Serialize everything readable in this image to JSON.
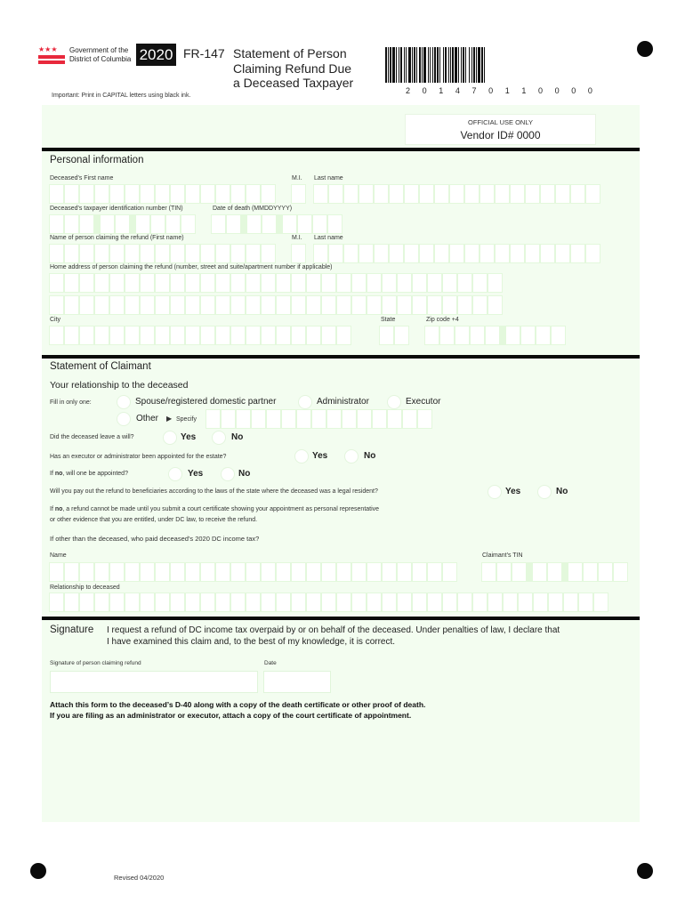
{
  "header": {
    "agency_line1": "Government of the",
    "agency_line2": "District of Columbia",
    "flag_stars": "★★★",
    "year": "2020",
    "form_number": "FR-147",
    "title_line1": "Statement of Person",
    "title_line2": "Claiming Refund Due",
    "title_line3": "a Deceased Taxpayer",
    "important_note": "Important: Print in CAPITAL letters using black ink.",
    "barcode_digits": [
      "2",
      "0",
      "1",
      "4",
      "7",
      "0",
      "1",
      "1",
      "0",
      "0",
      "0",
      "0"
    ],
    "official_use_label": "OFFICIAL USE ONLY",
    "vendor_id": "Vendor ID# 0000"
  },
  "personal": {
    "section_title": "Personal information",
    "deceased_first_name_label": "Deceased's First name",
    "mi_label": "M.I.",
    "last_name_label": "Last name",
    "tin_label": "Deceased's taxpayer identification number (TIN)",
    "date_of_death_label": "Date of death (MMDDYYYY)",
    "claimant_first_name_label": "Name of person claiming the refund (First name)",
    "claimant_mi_label": "M.I.",
    "claimant_last_name_label": "Last name",
    "address_label": "Home address of person claiming the refund (number, street and suite/apartment number if applicable)",
    "city_label": "City",
    "state_label": "State",
    "zip_label": "Zip code +4"
  },
  "claimant": {
    "section_title": "Statement of Claimant",
    "relationship_heading": "Your relationship to the deceased",
    "fill_in_label": "Fill in only one:",
    "options": {
      "spouse": "Spouse/registered domestic partner",
      "administrator": "Administrator",
      "executor": "Executor",
      "other": "Other",
      "specify": "Specify"
    },
    "q_will": "Did the deceased leave a will?",
    "q_appointed": "Has an executor or administrator been appointed for the estate?",
    "q_will_be_appointed_prefix": "If ",
    "q_will_be_appointed_bold": "no",
    "q_will_be_appointed_rest": ", will one be appointed?",
    "q_payout": "Will you pay out the refund to beneficiaries according to the laws of the state where the deceased was a legal resident?",
    "note_prefix": "If ",
    "note_bold": "no",
    "note_line1_rest": ", a refund cannot be made until you submit a court certificate showing your appointment as personal representative",
    "note_line2": "or other evidence that you are entitled, under DC law, to receive the refund.",
    "q_who_paid": "If other than the deceased, who paid deceased's 2020 DC income tax?",
    "name_label": "Name",
    "claimant_tin_label": "Claimant's TIN",
    "relationship_label": "Relationship to deceased",
    "yes": "Yes",
    "no": "No"
  },
  "signature": {
    "section_title": "Signature",
    "declaration_line1": "I request a refund of DC income tax overpaid by or on behalf of the deceased. Under penalties of law, I declare that",
    "declaration_line2": "I have examined this claim and, to the best of my knowledge, it is correct.",
    "signature_label": "Signature of person claiming refund",
    "date_label": "Date",
    "notice_line1": "Attach this form to the deceased’s D-40 along with a copy of the death certificate or other proof of death.",
    "notice_line2": "If you are filing as an administrator or executor, attach a copy of the court certificate of appointment."
  },
  "footer": {
    "revised": "Revised 04/2020"
  },
  "colors": {
    "panel": "#f3fdf0",
    "box_border": "#e3f8dc",
    "flag_red": "#e8283c"
  }
}
